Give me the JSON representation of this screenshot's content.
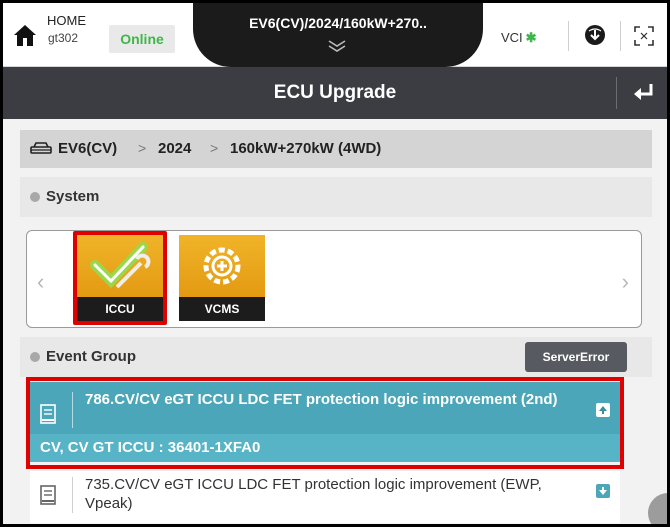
{
  "topbar": {
    "home_label": "HOME",
    "user": "gt302",
    "status": "Online",
    "vehicle_title": "EV6(CV)/2024/160kW+270..",
    "vci_label": "VCI"
  },
  "titlebar": {
    "title": "ECU Upgrade"
  },
  "breadcrumb": {
    "items": [
      "EV6(CV)",
      "2024",
      "160kW+270kW (4WD)"
    ],
    "separator": ">"
  },
  "system": {
    "label": "System",
    "tiles": [
      {
        "label": "ICCU",
        "icon": "check-wrench-icon",
        "selected": true
      },
      {
        "label": "VCMS",
        "icon": "plug-gear-icon",
        "selected": false
      }
    ]
  },
  "event_group": {
    "label": "Event Group",
    "server_button": "ServerError",
    "events": [
      {
        "title": "786.CV/CV eGT ICCU LDC FET protection logic improvement (2nd)",
        "subtitle": "CV, CV GT ICCU : 36401-1XFA0",
        "selected": true
      },
      {
        "title": "735.CV/CV eGT ICCU LDC FET protection logic improvement (EWP, Vpeak)",
        "selected": false
      }
    ]
  },
  "colors": {
    "accent_teal": "#4aa6b8",
    "online_green": "#3fb54a",
    "highlight_red": "#e00000",
    "tile_orange": "#f0b429"
  }
}
